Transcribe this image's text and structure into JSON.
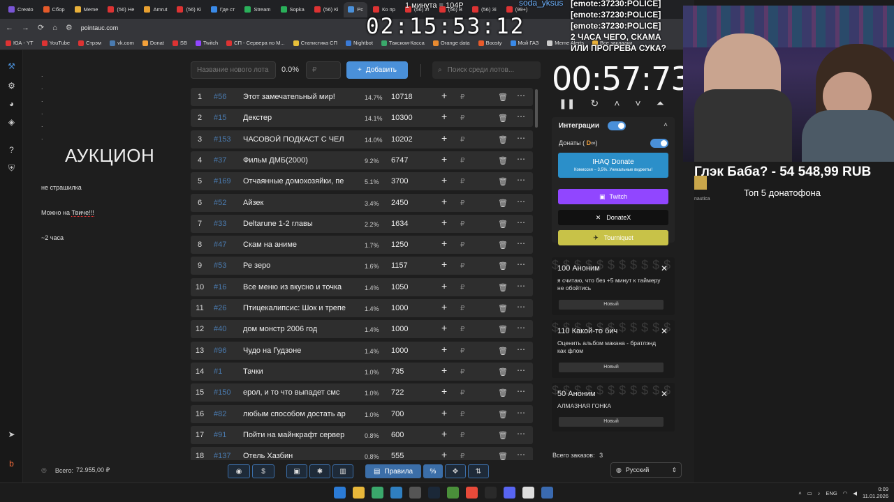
{
  "browser": {
    "tabs": [
      "Creato",
      "Сбор",
      "Meme",
      "(56) Не",
      "Amrut",
      "(56) Кі",
      "Где ст",
      "Stream",
      "Sopka",
      "(56) Кі",
      "Рс",
      "Ко пр",
      "(56) 2!",
      "(56) В",
      "(56) Зі",
      "(99+)"
    ],
    "url": "pointauc.com",
    "bookmarks": [
      "ЮА - YT",
      "YouTube",
      "Стрэм",
      "vk.com",
      "Donat",
      "SB",
      "Twitch",
      "СП - Сервера по М...",
      "Статистика СП",
      "Nightbot",
      "Такском-Касса",
      "Orange data",
      "Boosty",
      "Мой ГАЗ",
      "Meme Alerts",
      "Все закладки"
    ]
  },
  "left": {
    "title": "АУКЦИОН",
    "dots": [
      ".",
      ".",
      ".",
      ".",
      ".",
      "."
    ],
    "note1": "не страшилка",
    "note2_prefix": "Можно на ",
    "note2_link": "Твиче!!!",
    "note3": "~2 часа",
    "total_label": "Всего:",
    "total_value": "72.955,00 ₽"
  },
  "toolbar": {
    "name_placeholder": "Название нового лота",
    "percent": "0.0%",
    "amount_placeholder": "₽",
    "add_label": "Добавить",
    "search_placeholder": "Поиск среди лотов..."
  },
  "lots": [
    {
      "idx": "1",
      "id": "#56",
      "name": "Этот замечательный мир!",
      "pct": "14.7%",
      "amount": "10718"
    },
    {
      "idx": "2",
      "id": "#15",
      "name": "Декстер",
      "pct": "14.1%",
      "amount": "10300"
    },
    {
      "idx": "3",
      "id": "#153",
      "name": " ЧАСОВОЙ ПОДКАСТ С ЧЕЛ",
      "pct": "14.0%",
      "amount": "10202"
    },
    {
      "idx": "4",
      "id": "#37",
      "name": "Фильм ДМБ(2000)",
      "pct": "9.2%",
      "amount": "6747"
    },
    {
      "idx": "5",
      "id": "#169",
      "name": " Отчаянные домохозяйки, пе",
      "pct": "5.1%",
      "amount": "3700"
    },
    {
      "idx": "6",
      "id": "#52",
      "name": "Айзек",
      "pct": "3.4%",
      "amount": "2450"
    },
    {
      "idx": "7",
      "id": "#33",
      "name": "Deltarune 1-2 главы",
      "pct": "2.2%",
      "amount": "1634"
    },
    {
      "idx": "8",
      "id": "#47",
      "name": "Скам на аниме",
      "pct": "1.7%",
      "amount": "1250"
    },
    {
      "idx": "9",
      "id": "#53",
      "name": "Ре зеро",
      "pct": "1.6%",
      "amount": "1157"
    },
    {
      "idx": "10",
      "id": "#16",
      "name": "Все меню из вкусно и точка",
      "pct": "1.4%",
      "amount": "1050"
    },
    {
      "idx": "11",
      "id": "#26",
      "name": "Птицекалипсис: Шок и трепе",
      "pct": "1.4%",
      "amount": "1000"
    },
    {
      "idx": "12",
      "id": "#40",
      "name": "дом монстр 2006 год",
      "pct": "1.4%",
      "amount": "1000"
    },
    {
      "idx": "13",
      "id": "#96",
      "name": "Чудо на Гудзоне",
      "pct": "1.4%",
      "amount": "1000"
    },
    {
      "idx": "14",
      "id": "#1",
      "name": "Тачки",
      "pct": "1.0%",
      "amount": "735"
    },
    {
      "idx": "15",
      "id": "#150",
      "name": " ерол, и то что выпадет смс",
      "pct": "1.0%",
      "amount": "722"
    },
    {
      "idx": "16",
      "id": "#82",
      "name": "любым способом достать ар",
      "pct": "1.0%",
      "amount": "700"
    },
    {
      "idx": "17",
      "id": "#91",
      "name": "Пойти на майнкрафт сервер",
      "pct": "0.8%",
      "amount": "600"
    },
    {
      "idx": "18",
      "id": "#137",
      "name": "Отель Хазбин",
      "pct": "0.8%",
      "amount": "555"
    }
  ],
  "bottom_bar": {
    "rules_label": "Правила",
    "percent_symbol": "%"
  },
  "right": {
    "timer": "00:57:73",
    "integrations_title": "Интеграции",
    "donations_label": "Донаты (",
    "ihaq_label": "IHAQ Donate",
    "ihaq_sub": "Комиссия – 3,5%. Уникальные виджеты!",
    "twitch_label": "Twitch",
    "donatex_label": "DonateX",
    "tourniquet_label": "Tourniquet",
    "orders_label": "Всего заказов:",
    "orders_count": "3",
    "language": "Русский"
  },
  "donations": [
    {
      "title": "100 Аноним",
      "msg": "я считаю, что без +5 минут к таймеру не обойтись",
      "status": "Новый"
    },
    {
      "title": "110 Какой-то бич",
      "msg": "Оценить альбом макана - братлэнд как флом",
      "status": "Новый"
    },
    {
      "title": "50 Аноним",
      "msg": "АЛМАЗНАЯ ГОНКА",
      "status": "Новый"
    }
  ],
  "overlay": {
    "stream_timer": "02:15:53:12",
    "top_note": "1 минута = 104Р",
    "chat_user": "soda_yksus",
    "chat_lines": [
      "[emote:37230:POLICE]",
      "[emote:37230:POLICE]",
      "[emote:37230:POLICE]",
      "2 ЧАСА ЧЕГО, СКАМА",
      "ИЛИ ПРОГРЕВА СУКА?"
    ],
    "donor_title": "Глэк Баба? - 54 548,99 RUB",
    "donor_sub": "Топ  5 донатофона",
    "nautica": "nautica"
  },
  "taskbar": {
    "lang": "ENG",
    "time": "0:09",
    "date": "11.01.2026"
  },
  "colors": {
    "accent": "#4a90d9",
    "twitch": "#9146ff",
    "tourniquet": "#c8c248",
    "donatex": "#1a1a1a",
    "ihaq": "#2b8fc9",
    "lot_id": "#4a7bb0"
  }
}
